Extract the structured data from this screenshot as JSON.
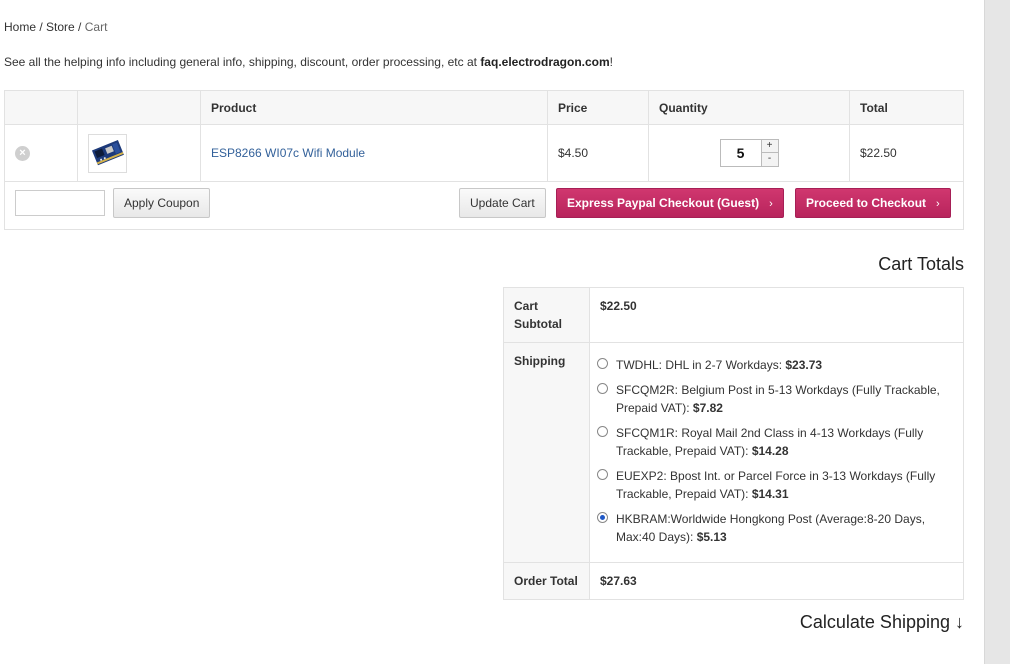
{
  "breadcrumb": {
    "home": "Home",
    "sep": " / ",
    "store": "Store",
    "current": "Cart"
  },
  "info": {
    "prefix": "See all the helping info including general info, shipping, discount, order processing, etc at ",
    "site": "faq.electrodragon.com",
    "suffix": "!"
  },
  "cart": {
    "headers": {
      "product": "Product",
      "price": "Price",
      "quantity": "Quantity",
      "total": "Total"
    },
    "item": {
      "remove_symbol": "×",
      "name": "ESP8266 WI07c Wifi Module",
      "price": "$4.50",
      "quantity": "5",
      "qty_plus": "+",
      "qty_minus": "-",
      "total": "$22.50"
    },
    "coupon_placeholder": "",
    "apply_coupon": "Apply Coupon",
    "update_cart": "Update Cart",
    "paypal": "Express Paypal Checkout (Guest)",
    "checkout": "Proceed to Checkout",
    "chevron": "›"
  },
  "totals": {
    "title": "Cart Totals",
    "subtotal_label_1": "Cart",
    "subtotal_label_2": "Subtotal",
    "subtotal": "$22.50",
    "shipping_label": "Shipping",
    "shipping_options": [
      {
        "text": "TWDHL: DHL in 2-7 Workdays: ",
        "price": "$23.73",
        "selected": false
      },
      {
        "text": "SFCQM2R: Belgium Post in 5-13 Workdays (Fully Trackable, Prepaid VAT): ",
        "price": "$7.82",
        "selected": false
      },
      {
        "text": "SFCQM1R: Royal Mail 2nd Class in 4-13 Workdays (Fully Trackable, Prepaid VAT): ",
        "price": "$14.28",
        "selected": false
      },
      {
        "text": "EUEXP2: Bpost Int. or Parcel Force in 3-13 Workdays (Fully Trackable, Prepaid VAT): ",
        "price": "$14.31",
        "selected": false
      },
      {
        "text": "HKBRAM:Worldwide Hongkong Post (Average:8-20 Days, Max:40 Days): ",
        "price": "$5.13",
        "selected": true
      }
    ],
    "order_total_label": "Order Total",
    "order_total": "$27.63"
  },
  "calculate_shipping": "Calculate Shipping ↓",
  "colors": {
    "accent": "#c42b65",
    "link": "#33619a",
    "radio_selected": "#1f58c6"
  }
}
